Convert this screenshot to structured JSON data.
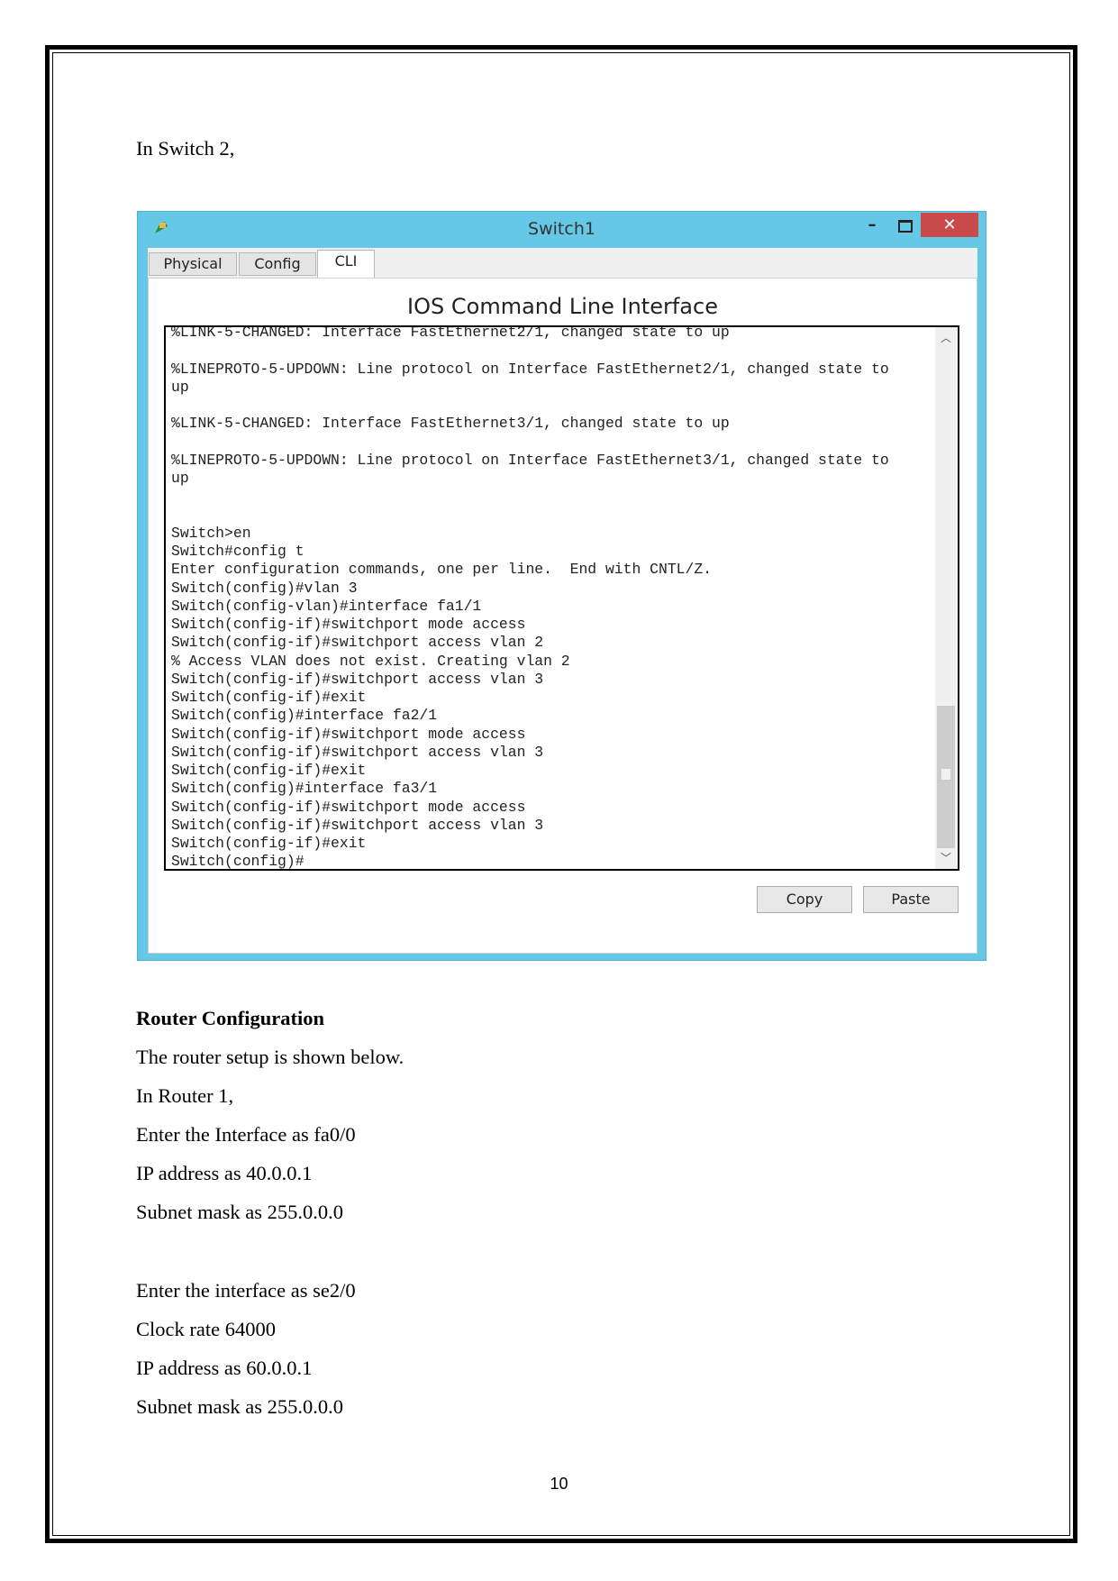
{
  "intro": "In Switch 2,",
  "window": {
    "title": "Switch1",
    "tabs": [
      {
        "label": "Physical"
      },
      {
        "label": "Config"
      },
      {
        "label": "CLI",
        "active": true
      }
    ],
    "panel_title": "IOS Command Line Interface",
    "terminal_lines": [
      "%LINK-5-CHANGED: Interface FastEthernet2/1, changed state to up",
      "",
      "%LINEPROTO-5-UPDOWN: Line protocol on Interface FastEthernet2/1, changed state to",
      "up",
      "",
      "%LINK-5-CHANGED: Interface FastEthernet3/1, changed state to up",
      "",
      "%LINEPROTO-5-UPDOWN: Line protocol on Interface FastEthernet3/1, changed state to",
      "up",
      "",
      "",
      "Switch>en",
      "Switch#config t",
      "Enter configuration commands, one per line.  End with CNTL/Z.",
      "Switch(config)#vlan 3",
      "Switch(config-vlan)#interface fa1/1",
      "Switch(config-if)#switchport mode access",
      "Switch(config-if)#switchport access vlan 2",
      "% Access VLAN does not exist. Creating vlan 2",
      "Switch(config-if)#switchport access vlan 3",
      "Switch(config-if)#exit",
      "Switch(config)#interface fa2/1",
      "Switch(config-if)#switchport mode access",
      "Switch(config-if)#switchport access vlan 3",
      "Switch(config-if)#exit",
      "Switch(config)#interface fa3/1",
      "Switch(config-if)#switchport mode access",
      "Switch(config-if)#switchport access vlan 3",
      "Switch(config-if)#exit",
      "Switch(config)#"
    ],
    "copy_label": "Copy",
    "paste_label": "Paste",
    "colors": {
      "titlebar": "#64c8e6",
      "close": "#c94a4a"
    }
  },
  "body": {
    "heading": "Router Configuration",
    "lines": [
      "The router setup is shown below.",
      "In Router 1,",
      "Enter the Interface as fa0/0",
      "IP address as 40.0.0.1",
      "Subnet mask as 255.0.0.0",
      "Enter the interface as se2/0",
      "Clock rate 64000",
      "IP address as 60.0.0.1",
      "Subnet mask as 255.0.0.0"
    ]
  },
  "page_number": "10"
}
